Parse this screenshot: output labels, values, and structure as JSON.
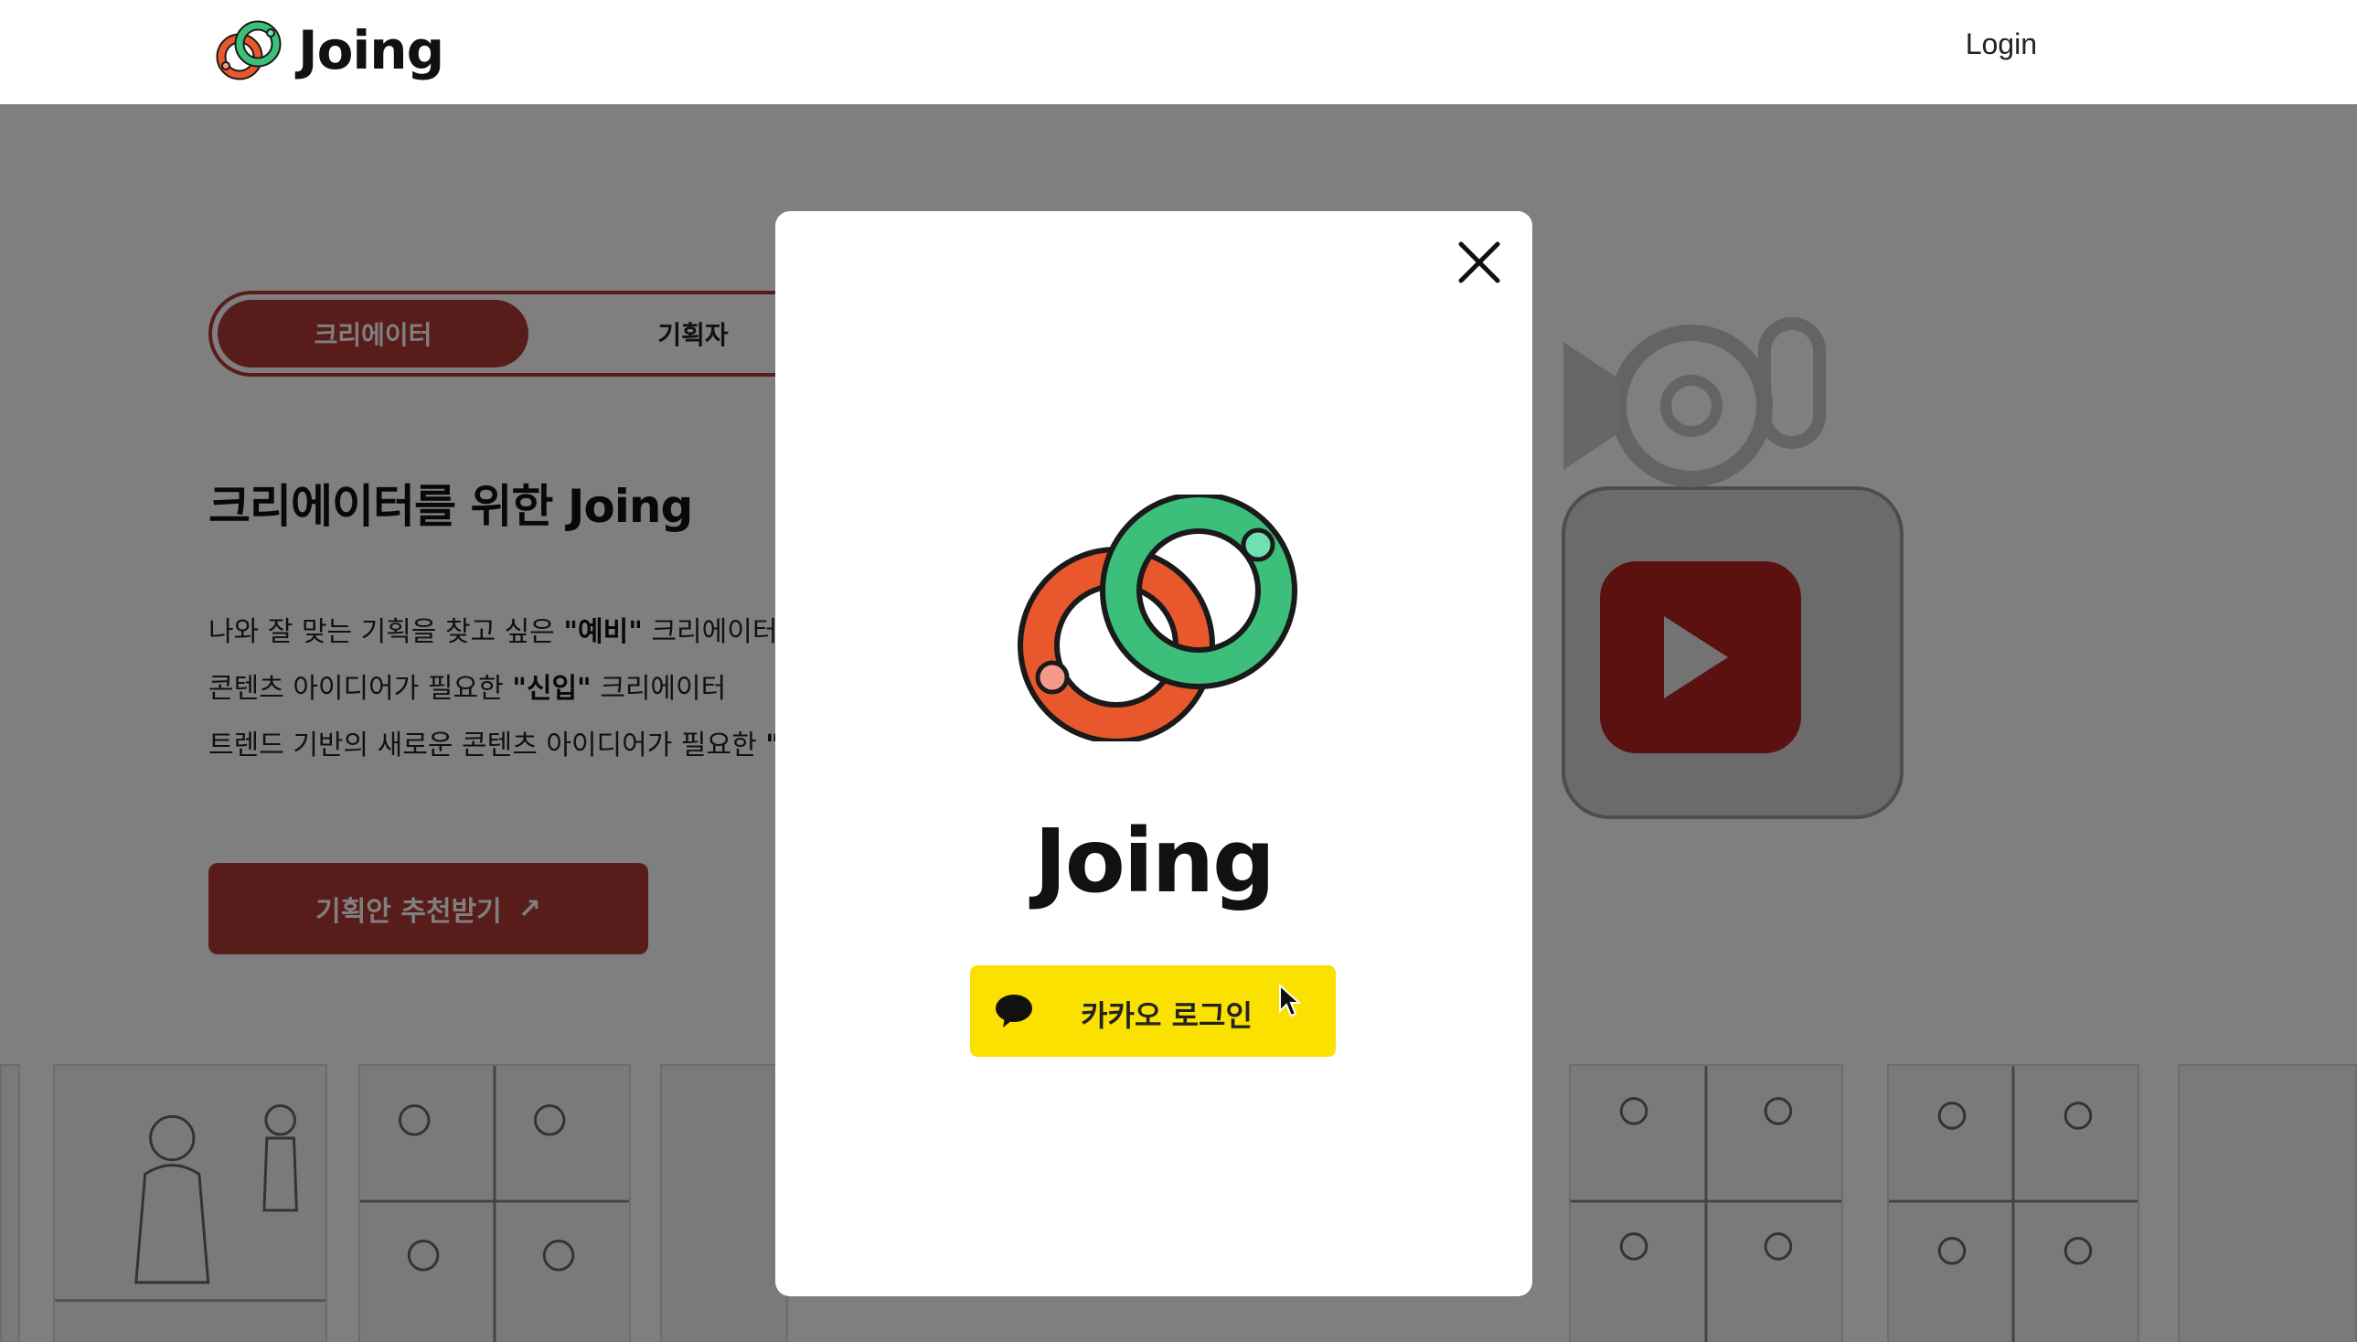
{
  "header": {
    "brand_name": "Joing",
    "login_label": "Login"
  },
  "page": {
    "toggle": {
      "creator_label": "크리에이터",
      "planner_label": "기획자",
      "active": "크리에이터"
    },
    "hero_title": "크리에이터를 위한 Joing",
    "lines": [
      {
        "pre": "나와 잘 맞는 기획을 찾고 싶은 ",
        "bold": "\"예비\"",
        "post": " 크리에이터"
      },
      {
        "pre": "콘텐츠 아이디어가 필요한 ",
        "bold": "\"신입\"",
        "post": " 크리에이터"
      },
      {
        "pre": "트렌드 기반의 새로운 콘텐츠 아이디어가 필요한 ",
        "bold": "\"전",
        "post": ""
      }
    ],
    "cta_label": "기획안 추천받기",
    "cta_arrow": "↗"
  },
  "modal": {
    "brand_name": "Joing",
    "close_icon": "close-icon",
    "kakao_login_label": "카카오 로그인",
    "kakao_icon": "speech-bubble-icon",
    "kakao_color": "#fae100"
  },
  "colors": {
    "accent": "#b03a35",
    "logo_orange": "#e8582c",
    "logo_green": "#3cbf7a",
    "overlay": "rgba(0,0,0,0.5)"
  }
}
